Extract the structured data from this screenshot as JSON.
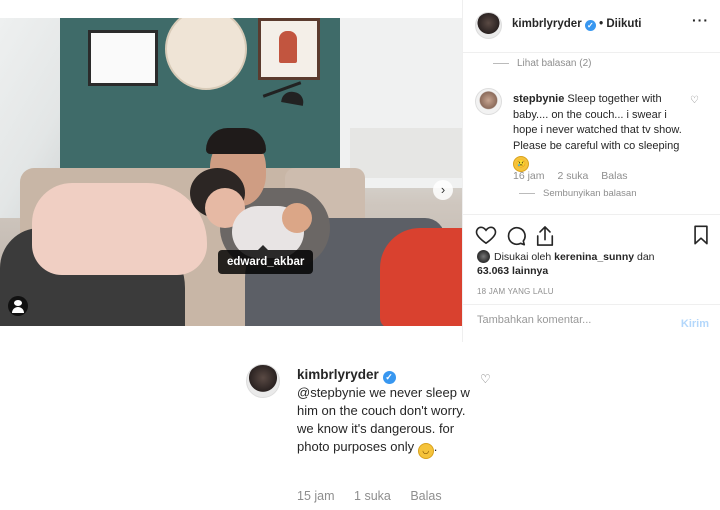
{
  "post": {
    "tag_username": "edward_akbar",
    "carousel_dots": 2,
    "carousel_active": 1
  },
  "header": {
    "username": "kimbrlyryder",
    "verified": true,
    "separator": "•",
    "follow_status": "Diikuti",
    "more_icon": "more-horizontal-icon"
  },
  "replies_toggle": "Lihat balasan (2)",
  "comment": {
    "username": "stepbynie",
    "text": "Sleep together with baby.... on the couch... i swear i hope i never watched that tv show. Please be careful with co sleeping",
    "emoji": "crying-face",
    "time": "16 jam",
    "likes": "2 suka",
    "reply_label": "Balas",
    "hide_replies": "Sembunyikan balasan"
  },
  "likes": {
    "prefix": "Disukai oleh",
    "user": "kerenina_sunny",
    "and": "dan",
    "count": "63.063 lainnya"
  },
  "time_ago": "18 JAM YANG LALU",
  "composer": {
    "placeholder": "Tambahkan komentar...",
    "submit": "Kirim"
  },
  "reply": {
    "username": "kimbrlyryder",
    "mention": "@stepbynie",
    "text": "we never sleep w him on the couch don't worry. we know it's dangerous. for photo purposes only",
    "emoji": "smiling-face",
    "time": "15 jam",
    "likes": "1 suka",
    "reply_label": "Balas"
  },
  "colors": {
    "verified": "#3897f0",
    "muted": "#8e8e8e",
    "kirim_disabled": "#b3d7fb",
    "tag_bg": "#000000"
  }
}
